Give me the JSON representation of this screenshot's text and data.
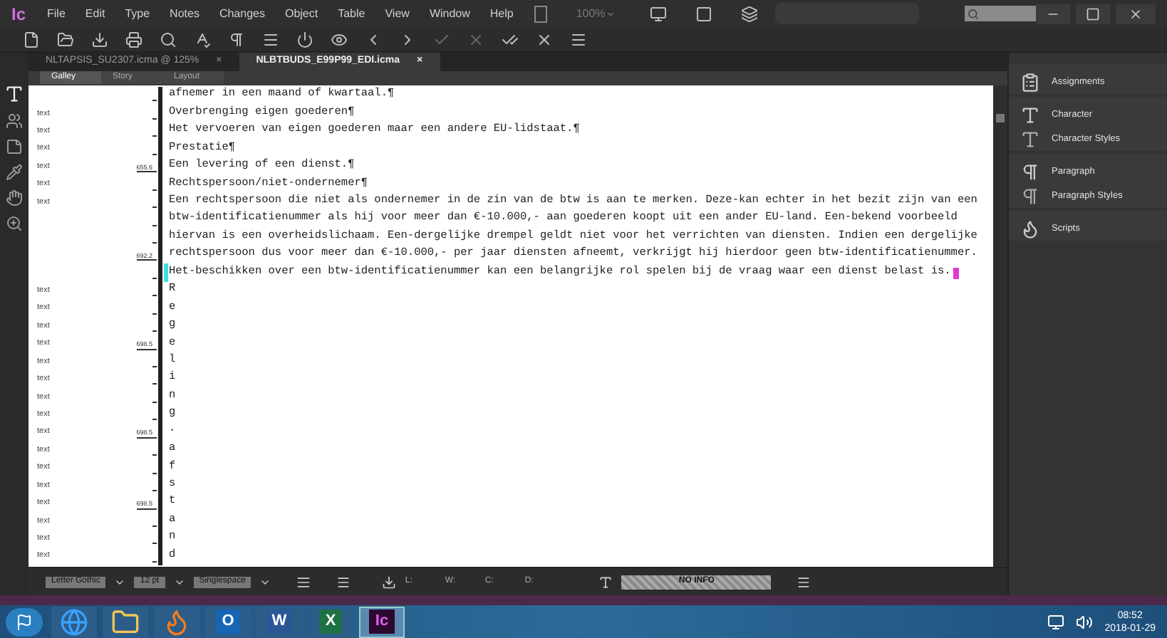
{
  "app": {
    "logo": "Ic",
    "zoom": "100%"
  },
  "menu": [
    "File",
    "Edit",
    "Type",
    "Notes",
    "Changes",
    "Object",
    "Table",
    "View",
    "Window",
    "Help"
  ],
  "doc_tabs": [
    {
      "label": "NLTAPSIS_SU2307.icma @ 125%",
      "close": "×",
      "selected": false
    },
    {
      "label": "NLBTBUDS_E99P99_EDI.icma",
      "close": "×",
      "selected": true
    }
  ],
  "view_tabs": [
    {
      "label": "Galley",
      "selected": true
    },
    {
      "label": "Story",
      "selected": false
    },
    {
      "label": "Layout",
      "selected": false
    }
  ],
  "lines": [
    {
      "text": "afnemer in een maand of kwartaal.¶"
    },
    {
      "label": "text",
      "text": "Overbrenging eigen goederen¶"
    },
    {
      "label": "text",
      "text": "Het vervoeren van eigen goederen maar een andere EU-lidstaat.¶"
    },
    {
      "label": "text",
      "text": "Prestatie¶"
    },
    {
      "label": "text",
      "depth": "655.6",
      "text": "Een levering of een dienst.¶"
    },
    {
      "label": "text",
      "text": "Rechtspersoon/niet-ondernemer¶"
    },
    {
      "label": "text",
      "text": "Een rechtspersoon die niet als ondernemer in de zin van de btw is aan te merken. Deze-kan echter in het bezit zijn van een"
    },
    {
      "text": "btw-identificatienummer als hij voor meer dan €-10.000,- aan goederen koopt uit een ander EU-land. Een-bekend voorbeeld"
    },
    {
      "text": "hiervan is een overheidslichaam. Een-dergelijke drempel geldt niet voor het verrichten van diensten. Indien een dergelijke"
    },
    {
      "depth": "692.2",
      "text": "rechtspersoon dus voor meer dan €-10.000,- per jaar diensten afneemt, verkrijgt hij hierdoor geen btw-identificatienummer."
    },
    {
      "changed": true,
      "cursor": true,
      "text": "Het-beschikken over een btw-identificatienummer kan een belangrijke rol spelen bij de vraag waar een dienst belast is."
    },
    {
      "label": "text",
      "text": "R"
    },
    {
      "label": "text",
      "text": "e"
    },
    {
      "label": "text",
      "text": "g"
    },
    {
      "label": "text",
      "depth": "698.5",
      "text": "e"
    },
    {
      "label": "text",
      "text": "l"
    },
    {
      "label": "text",
      "text": "i"
    },
    {
      "label": "text",
      "text": "n"
    },
    {
      "label": "text",
      "text": "g"
    },
    {
      "label": "text",
      "depth": "698.5",
      "text": "·"
    },
    {
      "label": "text",
      "text": "a"
    },
    {
      "label": "text",
      "text": "f"
    },
    {
      "label": "text",
      "text": "s"
    },
    {
      "label": "text",
      "depth": "698.5",
      "text": "t"
    },
    {
      "label": "text",
      "text": "a"
    },
    {
      "label": "text",
      "text": "n"
    },
    {
      "label": "text",
      "text": "d"
    }
  ],
  "panels": [
    {
      "items": [
        {
          "kind": "assignments",
          "label": "Assignments"
        }
      ]
    },
    {
      "items": [
        {
          "kind": "character",
          "label": "Character"
        },
        {
          "kind": "character_styles",
          "label": "Character Styles"
        }
      ]
    },
    {
      "items": [
        {
          "kind": "paragraph",
          "label": "Paragraph"
        },
        {
          "kind": "paragraph_styles",
          "label": "Paragraph Styles"
        }
      ]
    },
    {
      "items": [
        {
          "kind": "scripts",
          "label": "Scripts"
        }
      ]
    }
  ],
  "status_bar": {
    "font": "Letter Gothic",
    "size": "12 pt",
    "spacing": "Singlespace",
    "counts": [
      "L:",
      "W:",
      "C:",
      "D:"
    ],
    "info": "NO INFO"
  },
  "taskbar": {
    "apps": [
      {
        "kind": "ie",
        "selected": false
      },
      {
        "kind": "explorer",
        "selected": false
      },
      {
        "kind": "firefox",
        "selected": false
      },
      {
        "kind": "outlook",
        "label": "O",
        "selected": false
      },
      {
        "kind": "word",
        "label": "W",
        "selected": false
      },
      {
        "kind": "excel",
        "label": "X",
        "selected": false
      },
      {
        "kind": "incopy",
        "label": "Ic",
        "selected": true
      }
    ],
    "time": "08:52",
    "date": "2018-01-29"
  }
}
